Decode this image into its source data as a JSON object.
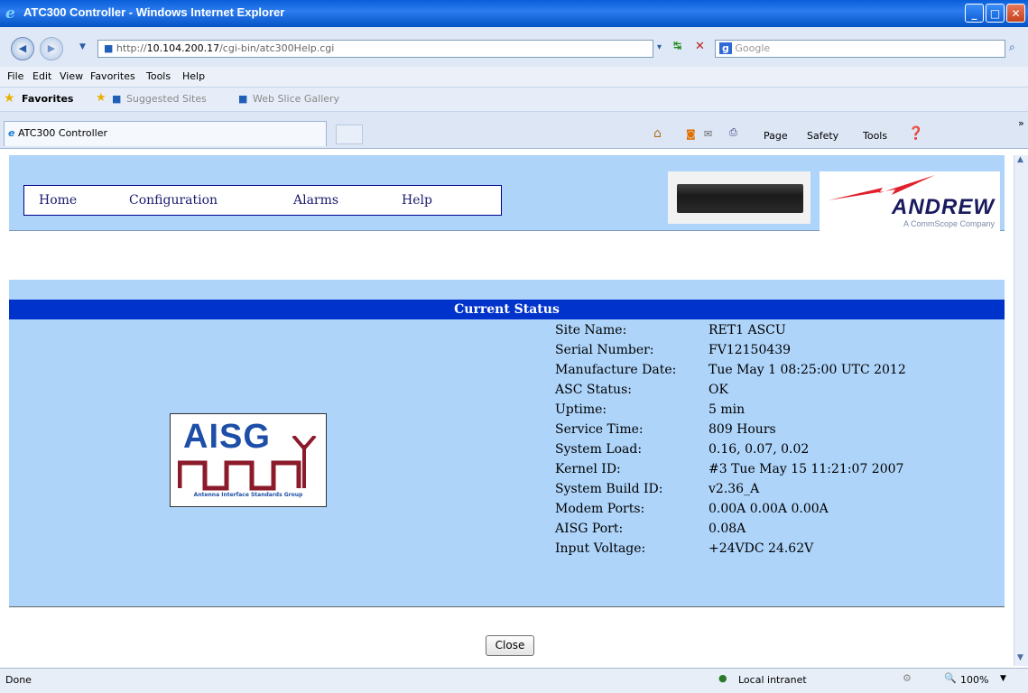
{
  "window": {
    "title": "ATC300 Controller - Windows Internet Explorer"
  },
  "addressbar": {
    "url_prefix": "http://",
    "url_host": "10.104.200.17",
    "url_path": "/cgi-bin/atc300Help.cgi",
    "search_placeholder": "Google"
  },
  "menu": {
    "items": [
      "File",
      "Edit",
      "View",
      "Favorites",
      "Tools",
      "Help"
    ]
  },
  "favorites": {
    "label": "Favorites",
    "suggested": "Suggested Sites",
    "slice": "Web Slice Gallery"
  },
  "tab": {
    "title": "ATC300 Controller"
  },
  "commandbar": {
    "page": "Page",
    "safety": "Safety",
    "tools": "Tools"
  },
  "nav": {
    "items": [
      "Home",
      "Configuration",
      "Alarms",
      "Help"
    ]
  },
  "logo": {
    "brand": "ANDREW",
    "sub": "A CommScope Company"
  },
  "status": {
    "heading": "Current Status",
    "rows": [
      {
        "label": "Site Name:",
        "value": "RET1 ASCU"
      },
      {
        "label": "Serial Number:",
        "value": "FV12150439"
      },
      {
        "label": "Manufacture Date:",
        "value": "Tue May 1 08:25:00 UTC 2012"
      },
      {
        "label": "ASC Status:",
        "value": "OK"
      },
      {
        "label": "Uptime:",
        "value": "5 min"
      },
      {
        "label": "Service Time:",
        "value": "809 Hours"
      },
      {
        "label": "System Load:",
        "value": "0.16, 0.07, 0.02"
      },
      {
        "label": "Kernel ID:",
        "value": "#3 Tue May 15 11:21:07 2007"
      },
      {
        "label": "System Build ID:",
        "value": "v2.36_A"
      },
      {
        "label": "Modem Ports:",
        "value": "0.00A 0.00A 0.00A"
      },
      {
        "label": "AISG Port:",
        "value": "0.08A"
      },
      {
        "label": "Input Voltage:",
        "value": "+24VDC 24.62V"
      }
    ]
  },
  "aisg": {
    "logo_text": "AISG",
    "caption": "Antenna Interface Standards Group"
  },
  "close_label": "Close",
  "statusbar": {
    "left": "Done",
    "zone": "Local intranet",
    "zoom": "100%"
  }
}
